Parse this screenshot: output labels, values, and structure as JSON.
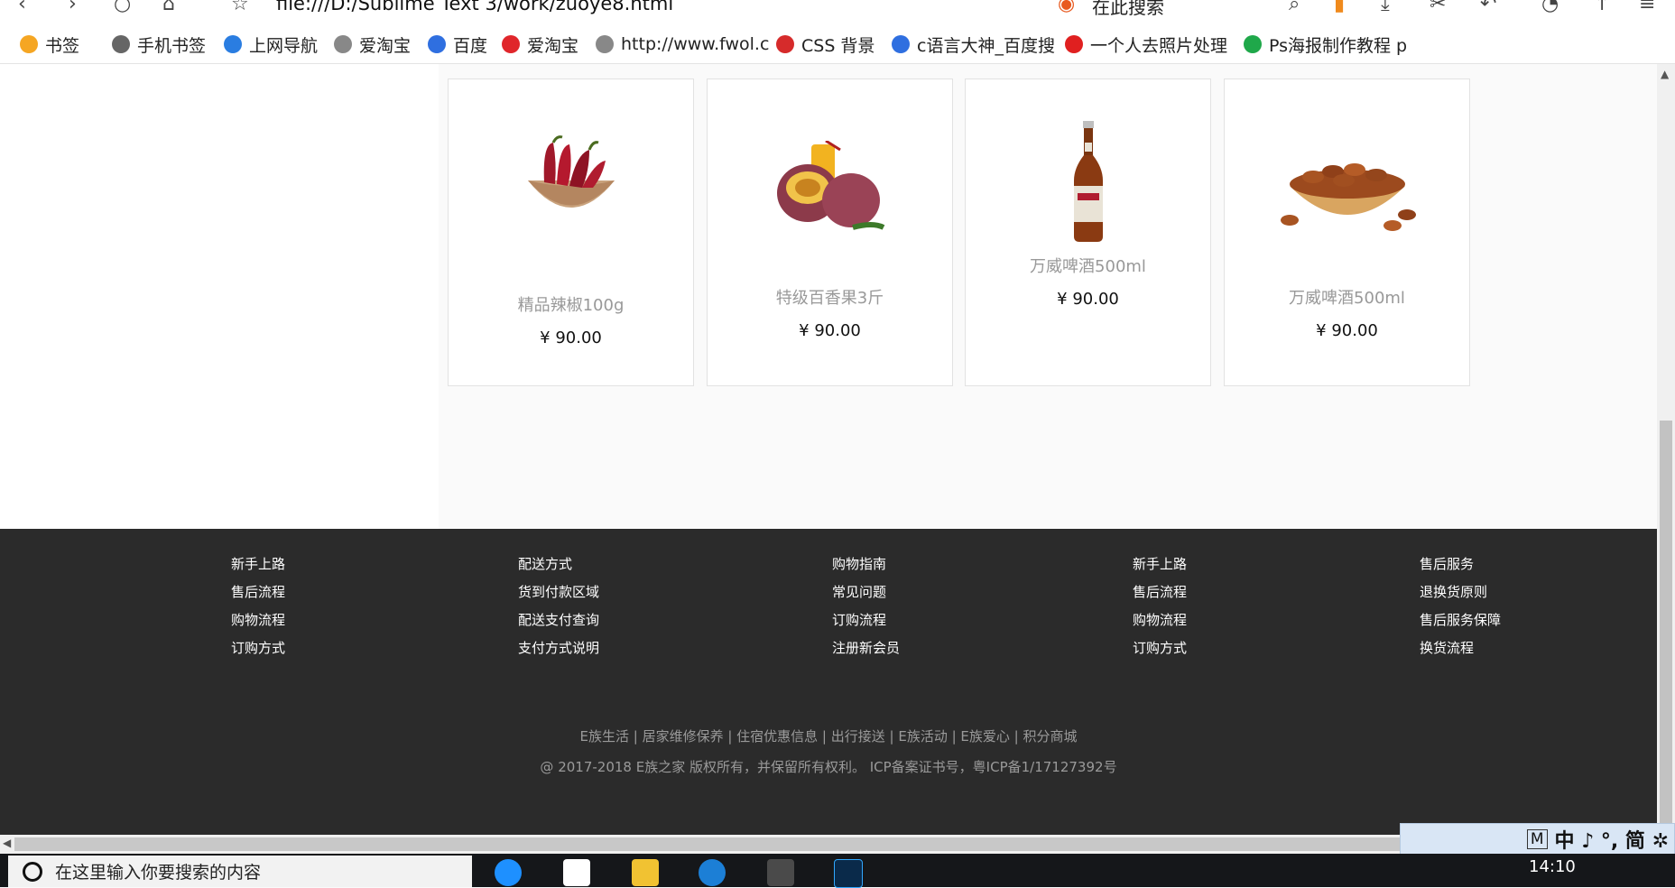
{
  "browser": {
    "address": "file:///D:/Sublime Text 3/work/zuoye8.html",
    "search_placeholder": "在此搜索",
    "bookmarks": [
      {
        "label": "书签",
        "icon": "star-icon",
        "color": "#f5a623"
      },
      {
        "label": "手机书签",
        "icon": "phone-icon",
        "color": "#666666"
      },
      {
        "label": "上网导航",
        "icon": "nav-icon",
        "color": "#2a7de1"
      },
      {
        "label": "爱淘宝",
        "icon": "globe-icon",
        "color": "#888888"
      },
      {
        "label": "百度",
        "icon": "baidu-icon",
        "color": "#2f6fe0"
      },
      {
        "label": "爱淘宝",
        "icon": "taobao-icon",
        "color": "#e0262b"
      },
      {
        "label": "http://www.fwol.c",
        "icon": "globe-icon",
        "color": "#888888"
      },
      {
        "label": "CSS 背景",
        "icon": "css-icon",
        "color": "#d62b2b"
      },
      {
        "label": "c语言大神_百度搜",
        "icon": "baidu-icon",
        "color": "#2f6fe0"
      },
      {
        "label": "一个人去照片处理",
        "icon": "video-icon",
        "color": "#e02020"
      },
      {
        "label": "Ps海报制作教程 p",
        "icon": "play-icon",
        "color": "#1fa84a"
      }
    ]
  },
  "products": [
    {
      "name": "精品辣椒100g",
      "price": "¥ 90.00",
      "image": "chili-icon"
    },
    {
      "name": "特级百香果3斤",
      "price": "¥ 90.00",
      "image": "passion-fruit-icon"
    },
    {
      "name": "万威啤酒500ml",
      "price": "¥ 90.00",
      "image": "beer-bottle-icon"
    },
    {
      "name": "万威啤酒500ml",
      "price": "¥ 90.00",
      "image": "nuts-bowl-icon"
    }
  ],
  "footer": {
    "columns": [
      [
        "新手上路",
        "售后流程",
        "购物流程",
        "订购方式"
      ],
      [
        "配送方式",
        "货到付款区域",
        "配送支付查询",
        "支付方式说明"
      ],
      [
        "购物指南",
        "常见问题",
        "订购流程",
        "注册新会员"
      ],
      [
        "新手上路",
        "售后流程",
        "购物流程",
        "订购方式"
      ],
      [
        "售后服务",
        "退换货原则",
        "售后服务保障",
        "换货流程"
      ]
    ],
    "links": "E族生活 | 居家维修保养 | 住宿优惠信息 | 出行接送 | E族活动 | E族爱心 | 积分商城",
    "copyright": "@ 2017-2018 E族之家 版权所有，并保留所有权利。 ICP备案证书号，粤ICP备1/17127392号"
  },
  "ime": {
    "mode": "M",
    "chars": "中 ♪ °, 简 ✲"
  },
  "taskbar": {
    "search_placeholder": "在这里输入你要搜索的内容",
    "time": "14:10"
  }
}
